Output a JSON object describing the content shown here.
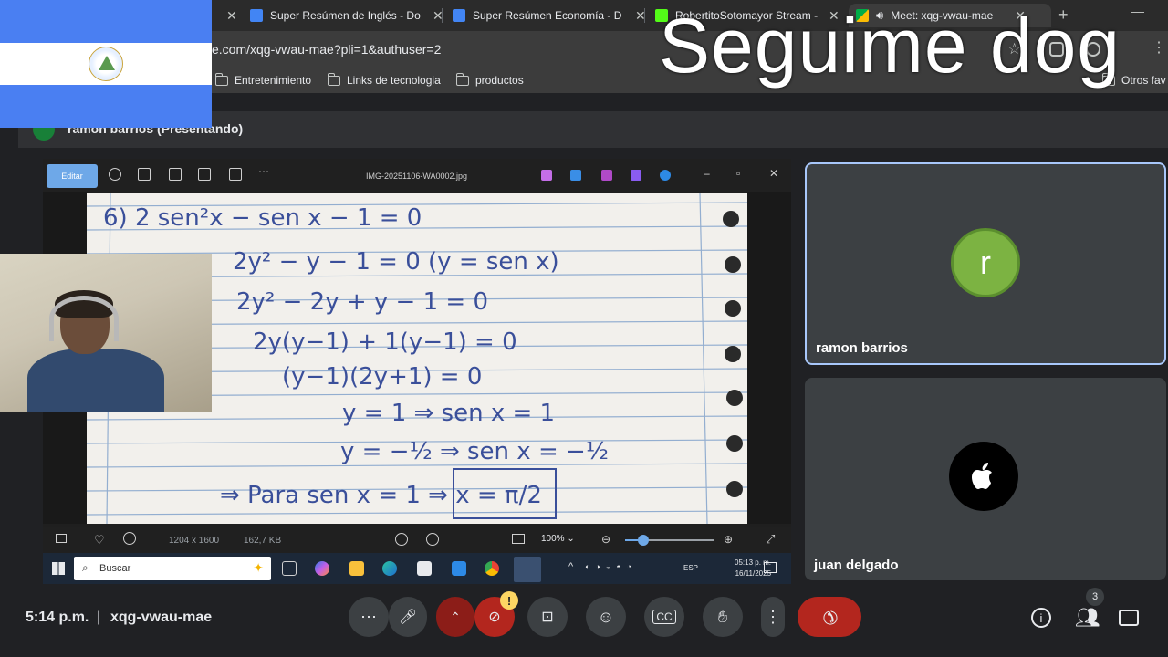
{
  "browser": {
    "tabs": [
      {
        "title": "Super Resúmen de Inglés - Do",
        "color": "#4285f4"
      },
      {
        "title": "Super Resúmen Economía - D",
        "color": "#4285f4"
      },
      {
        "title": "RobertitoSotomayor Stream -",
        "color": "#53fc18"
      },
      {
        "title": "Meet: xqg-vwau-mae",
        "color": "#00ac47",
        "active": true
      }
    ],
    "url": "e.com/xqg-vwau-mae?pli=1&authuser=2",
    "bookmarks": [
      "Entretenimiento",
      "Links de tecnologia",
      "productos"
    ],
    "bookmark_other": "Otros fav"
  },
  "overlay": {
    "watermark_text": "Seguime dog"
  },
  "meet": {
    "presenter_label": "ramon barrios (Presentando)",
    "presenter_initial": "r",
    "shared_screen": {
      "edit_label": "Editar",
      "file_title": "IMG-20251106-WA0002.jpg",
      "image_dimensions": "1204 x 1600",
      "file_size": "162,7 KB",
      "zoom": "100%",
      "zoom_level": 0.2,
      "taskbar": {
        "search_placeholder": "Buscar",
        "language": "ESP",
        "time": "05:13 p. m.",
        "date": "16/11/2025"
      },
      "math_lines": [
        "6)  2 sen²x − sen x − 1 = 0",
        "2y² − y − 1 = 0     (y = sen x)",
        "2y² − 2y + y − 1 = 0",
        "2y(y−1) + 1(y−1) = 0",
        "(y−1)(2y+1) = 0",
        "y = 1     ⇒ sen x = 1",
        "y = −½     ⇒ sen x = −½",
        "⇒ Para sen x = 1  ⇒  x = π/2"
      ]
    },
    "participants": [
      {
        "name": "ramon barrios",
        "initial": "r",
        "avatar_color": "#7cb342"
      },
      {
        "name": "juan delgado",
        "avatar_color": "#000000"
      }
    ],
    "controls": {
      "time": "5:14 p.m.",
      "separator": "|",
      "meeting_code": "xqg-vwau-mae",
      "warning_badge": "!",
      "participant_count": "3"
    }
  }
}
